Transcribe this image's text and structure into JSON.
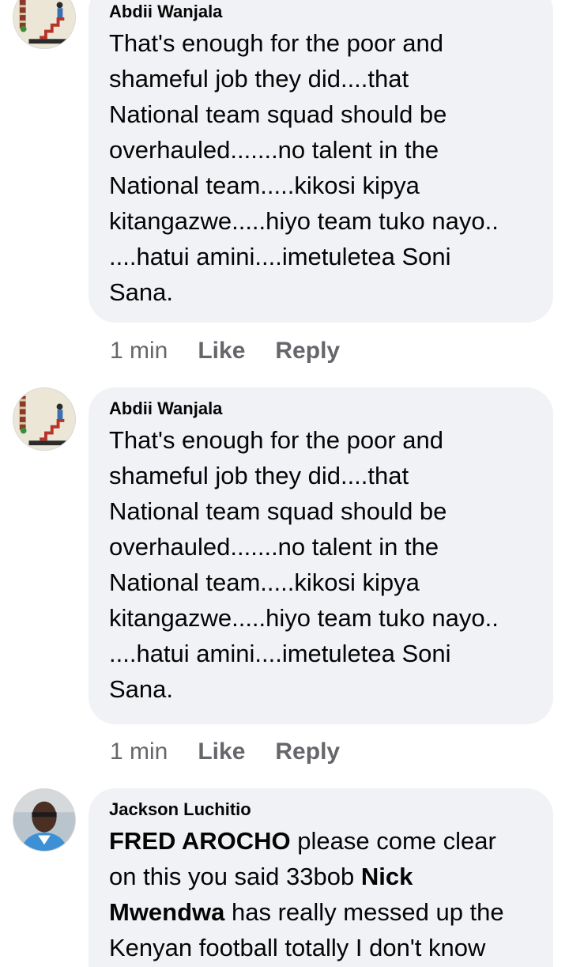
{
  "comments": [
    {
      "author": "Abdii Wanjala",
      "text": "That's enough for the poor and\nshameful job they did....that\nNational team squad should be\noverhauled.......no talent in the\nNational team.....kikosi kipya\nkitangazwe.....hiyo team tuko nayo..\n....hatui amini....imetuletea Soni\nSana.",
      "time": "1 min",
      "like_label": "Like",
      "reply_label": "Reply",
      "avatar_icon": "staircase-figure-avatar"
    },
    {
      "author": "Abdii Wanjala",
      "text": "That's enough for the poor and\nshameful job they did....that\nNational team squad should be\noverhauled.......no talent in the\nNational team.....kikosi kipya\nkitangazwe.....hiyo team tuko nayo..\n....hatui amini....imetuletea Soni\nSana.",
      "time": "1 min",
      "like_label": "Like",
      "reply_label": "Reply",
      "avatar_icon": "staircase-figure-avatar"
    },
    {
      "author": "Jackson Luchitio",
      "mention_1": "FRED AROCHO",
      "text_1": " please come clear\non this you said 33bob ",
      "mention_2": "Nick\nMwendwa",
      "text_2": " has really messed up the\nKenyan football totally I don't know",
      "avatar_icon": "person-photo-avatar"
    }
  ],
  "colors": {
    "bubble_bg": "#f0f2f5",
    "meta_text": "#65676b",
    "primary_text": "#050505"
  }
}
